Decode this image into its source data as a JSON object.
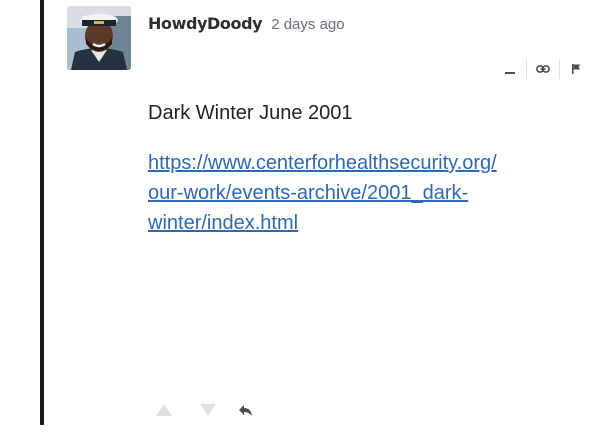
{
  "comment": {
    "author": "HowdyDoody",
    "timestamp": "2 days ago",
    "text": "Dark Winter June 2001",
    "link": {
      "line1": "https://www.centerforhealthsecurity.org/",
      "line2": "our-work/events-archive/2001_dark-",
      "line3": "winter/index.html"
    }
  },
  "actions": {
    "collapse_label": "−",
    "icons": [
      "minus-icon",
      "link-icon",
      "flag-icon"
    ]
  },
  "footer": {
    "icons": [
      "upvote-icon",
      "downvote-icon",
      "reply-icon"
    ]
  },
  "colors": {
    "thread_line": "#1a1a1a",
    "link": "#2e68b8",
    "muted": "#656c7a",
    "vote_icon": "#dfe1e6"
  }
}
